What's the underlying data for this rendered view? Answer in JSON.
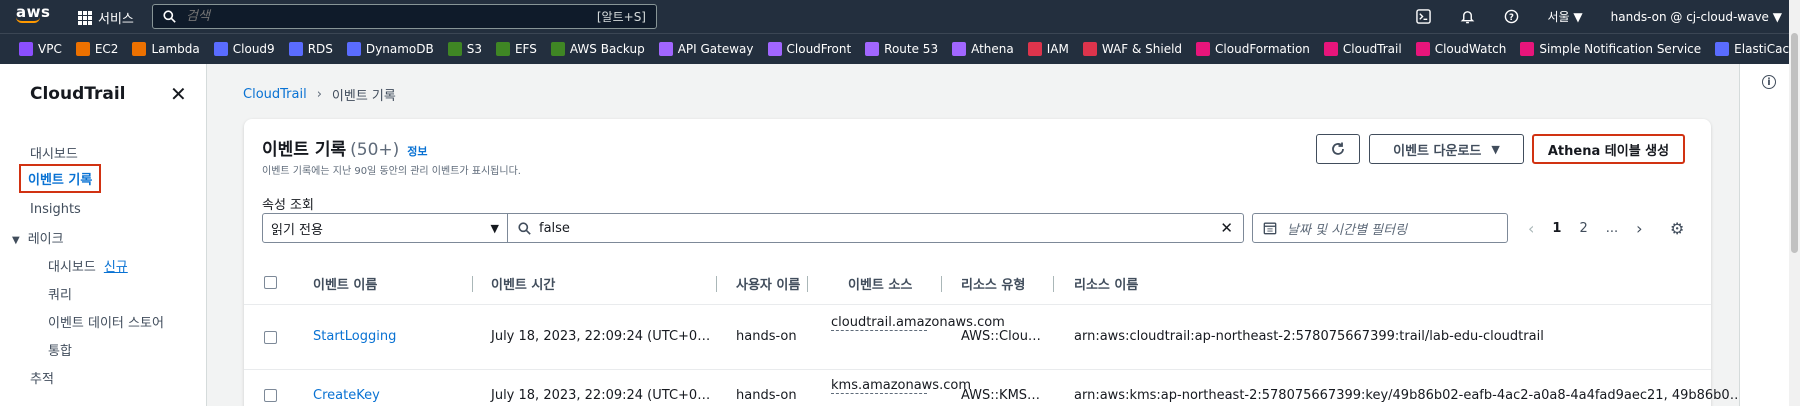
{
  "topnav": {
    "logo": "aws",
    "services": "서비스",
    "search_placeholder": "검색",
    "search_shortcut": "[알트+S]",
    "region": "서울 ▼",
    "account": "hands-on @ cj-cloud-wave ▼",
    "icons": [
      "cloudshell-icon",
      "bell-icon",
      "help-icon"
    ]
  },
  "favorites": [
    {
      "label": "VPC",
      "color": "#8c4fff"
    },
    {
      "label": "EC2",
      "color": "#ed7100"
    },
    {
      "label": "Lambda",
      "color": "#ed7100"
    },
    {
      "label": "Cloud9",
      "color": "#5a6cff"
    },
    {
      "label": "RDS",
      "color": "#5a6cff"
    },
    {
      "label": "DynamoDB",
      "color": "#5a6cff"
    },
    {
      "label": "S3",
      "color": "#3f8624"
    },
    {
      "label": "EFS",
      "color": "#3f8624"
    },
    {
      "label": "AWS Backup",
      "color": "#3f8624"
    },
    {
      "label": "API Gateway",
      "color": "#a166ff"
    },
    {
      "label": "CloudFront",
      "color": "#a166ff"
    },
    {
      "label": "Route 53",
      "color": "#a166ff"
    },
    {
      "label": "Athena",
      "color": "#a166ff"
    },
    {
      "label": "IAM",
      "color": "#dd344c"
    },
    {
      "label": "WAF & Shield",
      "color": "#dd344c"
    },
    {
      "label": "CloudFormation",
      "color": "#e7157b"
    },
    {
      "label": "CloudTrail",
      "color": "#e7157b"
    },
    {
      "label": "CloudWatch",
      "color": "#e7157b"
    },
    {
      "label": "Simple Notification Service",
      "color": "#e7157b"
    },
    {
      "label": "ElastiCache",
      "color": "#5a6cff"
    }
  ],
  "sidebar": {
    "title": "CloudTrail",
    "items": {
      "dashboard": "대시보드",
      "event_history": "이벤트 기록",
      "insights": "Insights",
      "lake": "레이크",
      "lake_dashboard": "대시보드",
      "lake_new": "신규",
      "query": "쿼리",
      "event_data_store": "이벤트 데이터 스토어",
      "integration": "통합",
      "trails": "추적"
    }
  },
  "breadcrumb": {
    "root": "CloudTrail",
    "current": "이벤트 기록"
  },
  "panel": {
    "title": "이벤트 기록",
    "count": "(50+)",
    "info": "정보",
    "description": "이벤트 기록에는 지난 90일 동안의 관리 이벤트가 표시됩니다.",
    "download_label": "이벤트 다운로드",
    "athena_label": "Athena 테이블 생성",
    "prop_label": "속성 조회",
    "select_value": "읽기 전용",
    "filter_value": "false",
    "date_placeholder": "날짜 및 시간별 필터링",
    "pages": [
      "1",
      "2",
      "..."
    ]
  },
  "table": {
    "headers": {
      "name": "이벤트 이름",
      "time": "이벤트 시간",
      "user": "사용자 이름",
      "source": "이벤트 소스",
      "rtype": "리소스 유형",
      "rname": "리소스 이름"
    },
    "rows": [
      {
        "name": "StartLogging",
        "time": "July 18, 2023, 22:09:24 (UTC+0…",
        "user": "hands-on",
        "source": "cloudtrail.amazonaws.com",
        "rtype": "AWS::Clou…",
        "rname": "arn:aws:cloudtrail:ap-northeast-2:578075667399:trail/lab-edu-cloudtrail"
      },
      {
        "name": "CreateKey",
        "time": "July 18, 2023, 22:09:24 (UTC+0…",
        "user": "hands-on",
        "source": "kms.amazonaws.com",
        "rtype": "AWS::KMS…",
        "rname": "arn:aws:kms:ap-northeast-2:578075667399:key/49b86b02-eafb-4ac2-a0a8-4a4fad9aec21, 49b86b0…"
      }
    ]
  }
}
